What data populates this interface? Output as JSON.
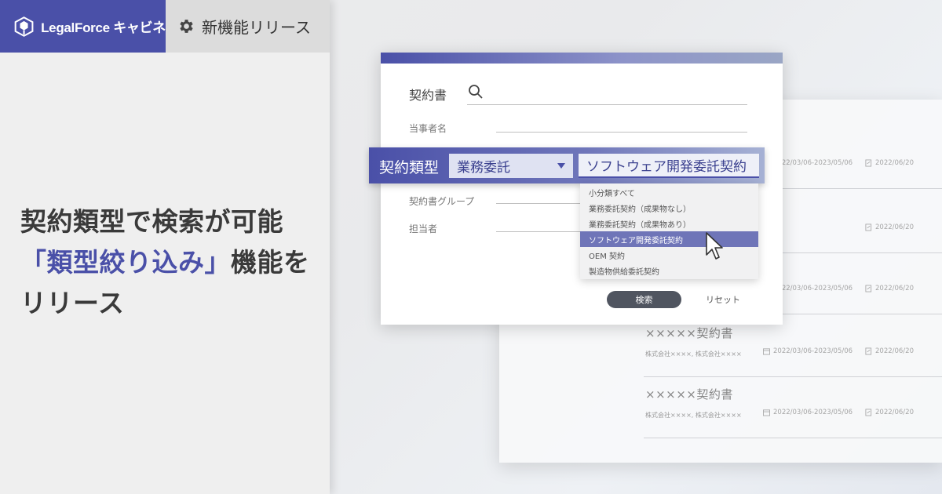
{
  "brand": {
    "name": "LegalForce キャビネ",
    "accent_color": "#4a50a8"
  },
  "release_tab": {
    "icon": "gear-icon",
    "label": "新機能リリース"
  },
  "headline": {
    "line1": "契約類型で検索が可能",
    "line2_highlight": "「類型絞り込み」",
    "line2_rest": "機能を",
    "line3": "リリース"
  },
  "search_form": {
    "contract_label": "契約書",
    "search_icon": "search-icon",
    "party_label": "当事者名",
    "group_label": "契約書グループ",
    "assignee_label": "担当者",
    "search_button": "検索",
    "reset_link": "リセット"
  },
  "contract_type": {
    "label": "契約類型",
    "selected_type": "業務委託",
    "selected_subtype": "ソフトウェア開発委託契約",
    "options": [
      "小分類すべて",
      "業務委託契約（成果物なし）",
      "業務委託契約（成果物あり）",
      "ソフトウェア開発委託契約",
      "OEM 契約",
      "製造物供給委託契約"
    ],
    "selected_index": 3
  },
  "contract_list": [
    {
      "title": "",
      "parties": "",
      "period": "2022/03/06-2023/05/06",
      "updated": "2022/06/20"
    },
    {
      "title": "",
      "parties": "",
      "period": "",
      "updated": "2022/06/20"
    },
    {
      "title": "",
      "parties": "",
      "period": "2022/03/06-2023/05/06",
      "updated": "2022/06/20"
    },
    {
      "title": "×××××契約書",
      "parties": "株式会社××××, 株式会社××××",
      "period": "2022/03/06-2023/05/06",
      "updated": "2022/06/20"
    },
    {
      "title": "×××××契約書",
      "parties": "株式会社××××, 株式会社××××",
      "period": "2022/03/06-2023/05/06",
      "updated": "2022/06/20"
    }
  ]
}
